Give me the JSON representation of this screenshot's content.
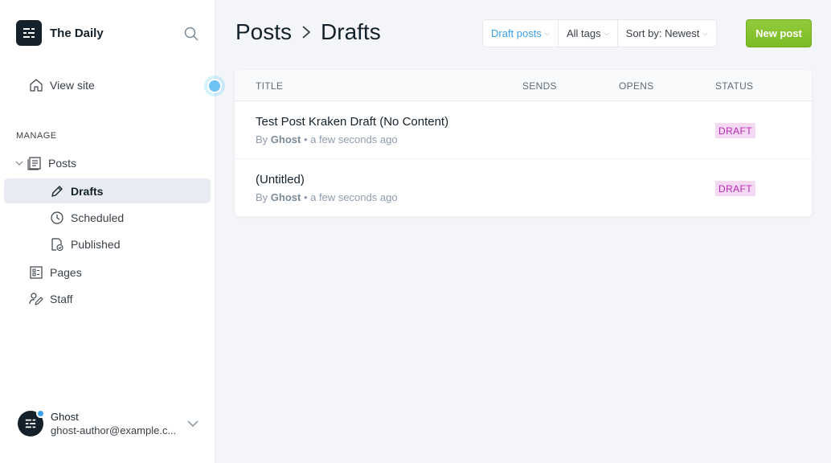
{
  "sidebar": {
    "brand_name": "The Daily",
    "view_site": "View site",
    "section_label": "MANAGE",
    "items": {
      "posts": "Posts",
      "drafts": "Drafts",
      "scheduled": "Scheduled",
      "published": "Published",
      "pages": "Pages",
      "staff": "Staff"
    },
    "user": {
      "name": "Ghost",
      "email": "ghost-author@example.c..."
    }
  },
  "header": {
    "breadcrumb_parent": "Posts",
    "breadcrumb_current": "Drafts",
    "filters": {
      "type": "Draft posts",
      "tags": "All tags",
      "sort": "Sort by: Newest"
    },
    "new_post_label": "New post"
  },
  "table": {
    "columns": {
      "title": "TITLE",
      "sends": "SENDS",
      "opens": "OPENS",
      "status": "STATUS"
    },
    "rows": [
      {
        "title": "Test Post Kraken Draft (No Content)",
        "by": "By",
        "author": "Ghost",
        "time": "• a few seconds ago",
        "status": "DRAFT"
      },
      {
        "title": "(Untitled)",
        "by": "By",
        "author": "Ghost",
        "time": "• a few seconds ago",
        "status": "DRAFT"
      }
    ]
  },
  "colors": {
    "accent": "#3aa0ea",
    "primary_button": "#7cbb26",
    "draft_badge_bg": "#f4d8f2",
    "draft_badge_text": "#b52ab0"
  }
}
